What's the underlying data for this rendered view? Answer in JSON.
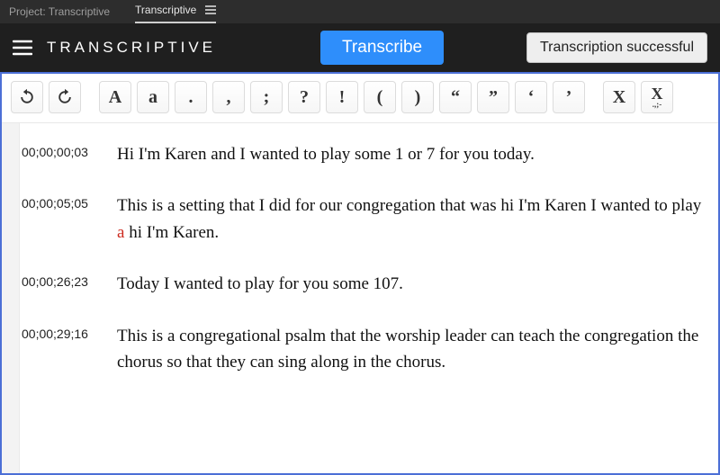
{
  "tabbar": {
    "project_label": "Project: Transcriptive",
    "active_tab": "Transcriptive"
  },
  "header": {
    "brand": "TRANSCRIPTIVE",
    "transcribe_label": "Transcribe",
    "status_label": "Transcription successful"
  },
  "toolbar": {
    "undo_icon": "undo",
    "redo_icon": "redo",
    "uppercase": "A",
    "lowercase": "a",
    "period": ".",
    "comma": ",",
    "semicolon": ";",
    "question": "?",
    "exclaim": "!",
    "paren_open": "(",
    "paren_close": ")",
    "dquote_open": "“",
    "dquote_close": "”",
    "squote_open": "‘",
    "squote_close": "’",
    "clear_word": "X",
    "clear_punct_top": "X",
    "clear_punct_sub": ".,;-"
  },
  "transcript": [
    {
      "tc": "00;00;00;03",
      "text": "Hi I'm Karen and I wanted to play some 1 or 7 for you today."
    },
    {
      "tc": "00;00;05;05",
      "text_parts": [
        {
          "t": "This is a setting that I did for our congregation that was hi I'm Karen I wanted to play "
        },
        {
          "t": "a",
          "err": true
        },
        {
          "t": " hi I'm Karen."
        }
      ]
    },
    {
      "tc": "00;00;26;23",
      "text": "Today I wanted to play for you some 107."
    },
    {
      "tc": "00;00;29;16",
      "text": "This is a congregational psalm that the worship leader can teach the congregation the chorus so that they can sing along in the chorus."
    }
  ]
}
